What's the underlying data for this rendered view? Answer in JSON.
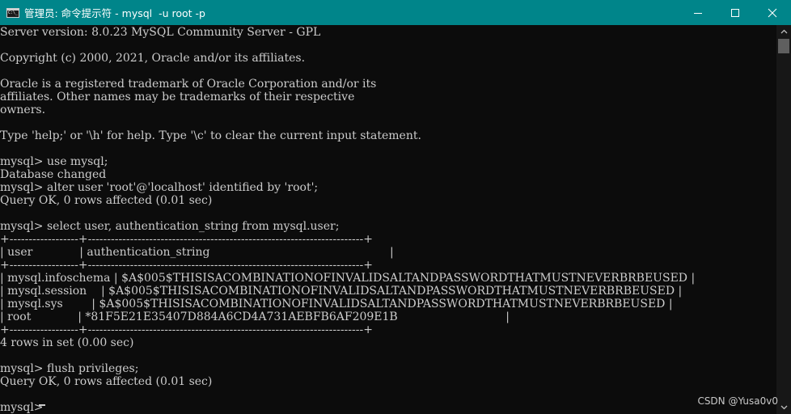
{
  "window": {
    "title": "管理员: 命令提示符 - mysql  -u root -p",
    "icon": "cmd-icon",
    "controls": [
      "minimize-icon",
      "maximize-icon",
      "close-icon"
    ]
  },
  "colors": {
    "titlebar": "#00858a",
    "console_background": "#0c0c0c",
    "console_text": "#cccccc"
  },
  "console": {
    "lines": [
      "Server version: 8.0.23 MySQL Community Server - GPL",
      "",
      "Copyright (c) 2000, 2021, Oracle and/or its affiliates.",
      "",
      "Oracle is a registered trademark of Oracle Corporation and/or its",
      "affiliates. Other names may be trademarks of their respective",
      "owners.",
      "",
      "Type 'help;' or '\\h' for help. Type '\\c' to clear the current input statement.",
      "",
      "mysql> use mysql;",
      "Database changed",
      "mysql> alter user 'root'@'localhost' identified by 'root';",
      "Query OK, 0 rows affected (0.01 sec)",
      "",
      "mysql> select user, authentication_string from mysql.user;",
      "+------------------+------------------------------------------------------------------------+",
      "| user             | authentication_string                                                  |",
      "+------------------+------------------------------------------------------------------------+",
      "| mysql.infoschema | $A$005$THISISACOMBINATIONOFINVALIDSALTANDPASSWORDTHATMUSTNEVERBRBEUSED |",
      "| mysql.session    | $A$005$THISISACOMBINATIONOFINVALIDSALTANDPASSWORDTHATMUSTNEVERBRBEUSED |",
      "| mysql.sys        | $A$005$THISISACOMBINATIONOFINVALIDSALTANDPASSWORDTHATMUSTNEVERBRBEUSED |",
      "| root             | *81F5E21E35407D884A6CD4A731AEBFB6AF209E1B                              |",
      "+------------------+------------------------------------------------------------------------+",
      "4 rows in set (0.00 sec)",
      "",
      "mysql> flush privileges;",
      "Query OK, 0 rows affected (0.01 sec)",
      "",
      "mysql> "
    ]
  },
  "watermark": "CSDN @Yusa0v0"
}
